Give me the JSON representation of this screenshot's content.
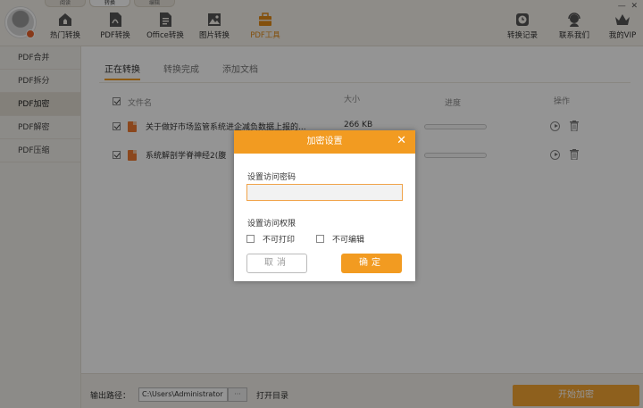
{
  "top_tabs": [
    "阅读",
    "转换",
    "编辑"
  ],
  "toolbar": {
    "hot": "热门转换",
    "pdf_convert": "PDF转换",
    "office_convert": "Office转换",
    "image_convert": "图片转换",
    "pdf_tools": "PDF工具",
    "history": "转换记录",
    "contact": "联系我们",
    "vip": "我的VIP"
  },
  "sidebar": {
    "items": [
      {
        "label": "PDF合并"
      },
      {
        "label": "PDF拆分"
      },
      {
        "label": "PDF加密"
      },
      {
        "label": "PDF解密"
      },
      {
        "label": "PDF压缩"
      }
    ]
  },
  "tabs": {
    "converting": "正在转换",
    "done": "转换完成",
    "add": "添加文档"
  },
  "table": {
    "col_name": "文件名",
    "col_size": "大小",
    "col_progress": "进度",
    "col_action": "操作",
    "rows": [
      {
        "name": "关于做好市场监管系统进企减负数据上报的...",
        "size": "266 KB",
        "progress": 0
      },
      {
        "name": "系统解剖学脊神经2(腹",
        "size": "",
        "progress": 0
      }
    ]
  },
  "bottom": {
    "output_label": "输出路径：",
    "path": "C:\\Users\\Administrator",
    "browse": "···",
    "open_dir": "打开目录",
    "start": "开始加密"
  },
  "dialog": {
    "title": "加密设置",
    "close": "✕",
    "password_label": "设置访问密码",
    "password_value": "",
    "permission_label": "设置访问权限",
    "no_print": "不可打印",
    "no_edit": "不可编辑",
    "cancel": "取消",
    "ok": "确定"
  },
  "colors": {
    "accent": "#f29b21",
    "overlay": "rgba(0,0,0,0.42)"
  }
}
